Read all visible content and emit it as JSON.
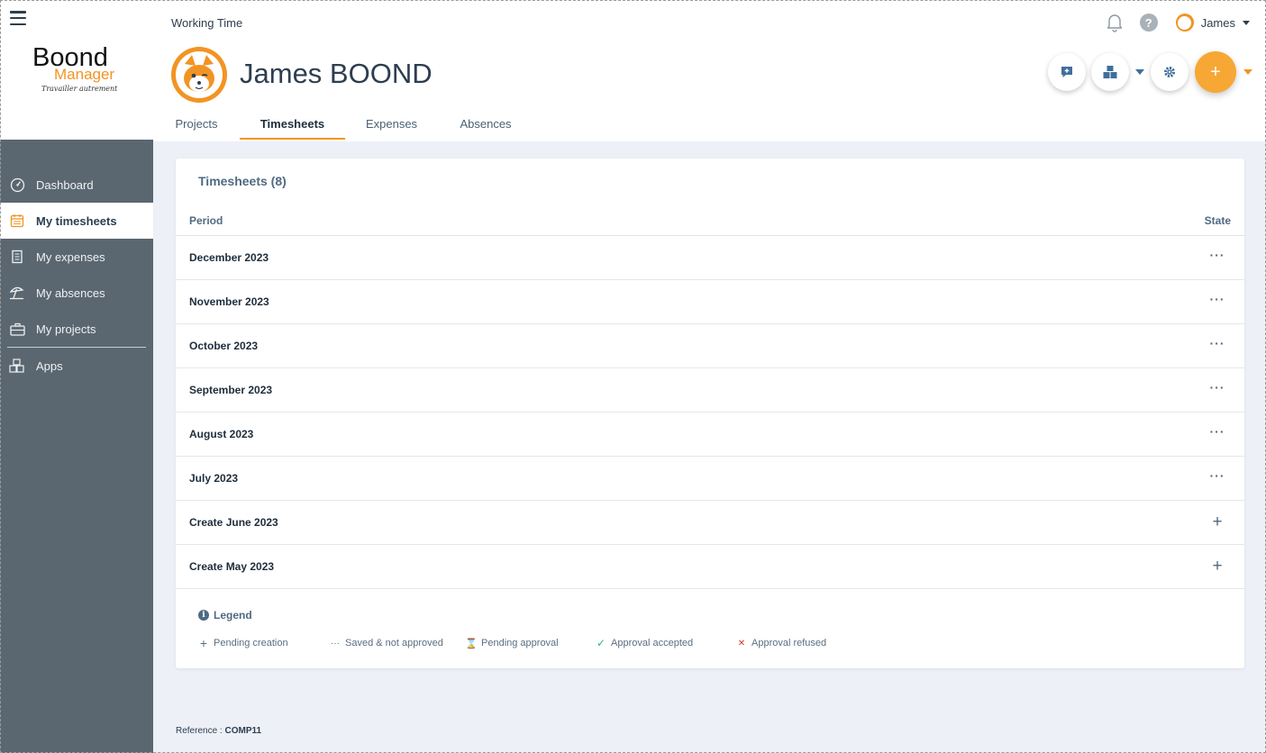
{
  "app": {
    "logo_text": "Boond",
    "logo_sub": "Manager",
    "logo_tagline": "Travailler autrement"
  },
  "sidebar": {
    "items": [
      {
        "label": "Dashboard",
        "icon": "dashboard-gauge-icon",
        "active": false
      },
      {
        "label": "My timesheets",
        "icon": "calendar-icon",
        "active": true
      },
      {
        "label": "My expenses",
        "icon": "receipt-icon",
        "active": false
      },
      {
        "label": "My absences",
        "icon": "beach-umbrella-icon",
        "active": false
      },
      {
        "label": "My projects",
        "icon": "briefcase-icon",
        "active": false
      },
      {
        "label": "Apps",
        "icon": "boxes-icon",
        "active": false
      }
    ]
  },
  "header": {
    "section": "Working Time",
    "user_full_name": "James BOOND",
    "user_short_name": "James",
    "help_label": "?",
    "tabs": [
      {
        "label": "Projects",
        "active": false
      },
      {
        "label": "Timesheets",
        "active": true
      },
      {
        "label": "Expenses",
        "active": false
      },
      {
        "label": "Absences",
        "active": false
      }
    ],
    "add_label": "+"
  },
  "card": {
    "title": "Timesheets (8)",
    "columns": {
      "period": "Period",
      "state": "State"
    },
    "rows": [
      {
        "period": "December 2023",
        "state": "···"
      },
      {
        "period": "November 2023",
        "state": "···"
      },
      {
        "period": "October 2023",
        "state": "···"
      },
      {
        "period": "September 2023",
        "state": "···"
      },
      {
        "period": "August 2023",
        "state": "···"
      },
      {
        "period": "July 2023",
        "state": "···"
      },
      {
        "period": "Create June 2023",
        "state": "+"
      },
      {
        "period": "Create May 2023",
        "state": "+"
      }
    ],
    "legend": {
      "info_glyph": "i",
      "title": "Legend",
      "items": [
        {
          "glyph": "+",
          "label": "Pending creation",
          "color": "#5b6e80"
        },
        {
          "glyph": "···",
          "label": "Saved & not approved",
          "color": "#5b6e80"
        },
        {
          "glyph": "⌛",
          "label": "Pending approval",
          "color": "#5b6e80"
        },
        {
          "glyph": "✓",
          "label": "Approval accepted",
          "color": "#2bb39a"
        },
        {
          "glyph": "✕",
          "label": "Approval refused",
          "color": "#d9342b"
        }
      ]
    }
  },
  "footer": {
    "reference_label": "Reference :",
    "reference_value": "COMP11"
  },
  "colors": {
    "accent": "#f29423",
    "sidebar_bg": "#5b6770",
    "page_bg": "#edf0f7"
  }
}
